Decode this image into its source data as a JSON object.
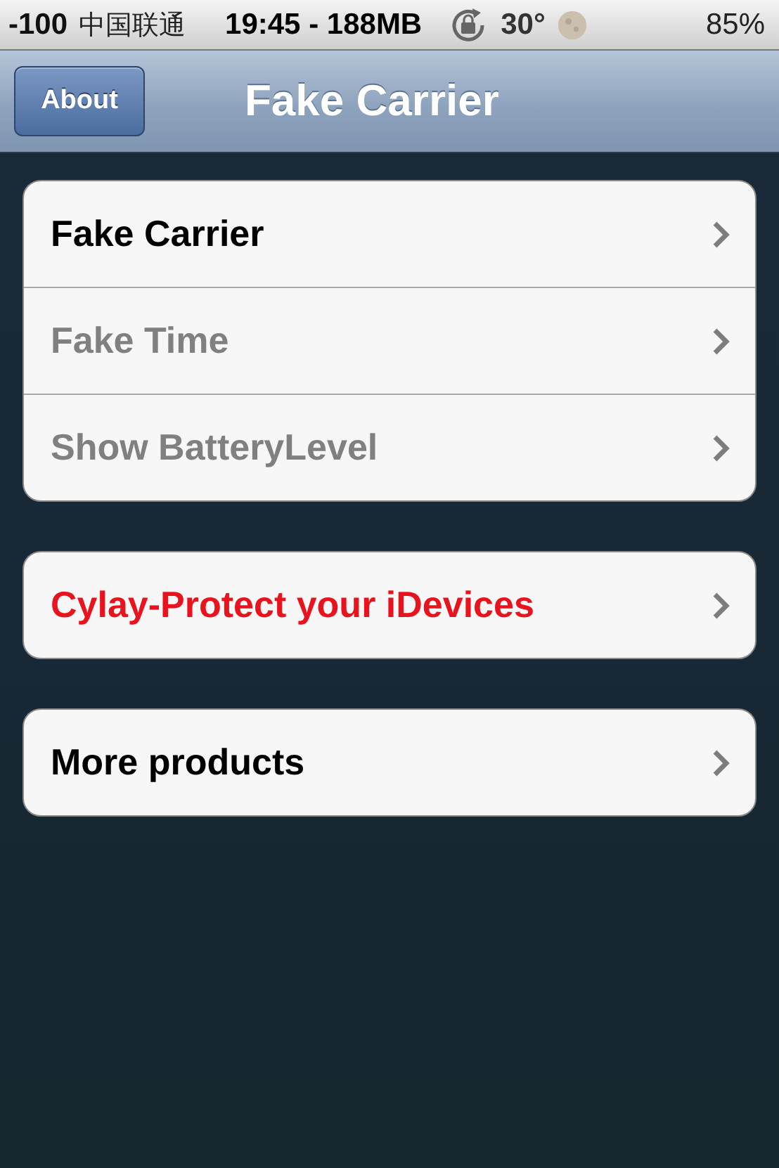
{
  "status_bar": {
    "signal": "-100",
    "carrier": "中国联通",
    "time": "19:45 - 188MB",
    "temperature": "30°",
    "battery": "85%"
  },
  "nav_bar": {
    "back_button": "About",
    "title": "Fake Carrier"
  },
  "groups": [
    {
      "rows": [
        {
          "label": "Fake Carrier",
          "kind": "normal"
        },
        {
          "label": "Fake Time",
          "kind": "dimmed"
        },
        {
          "label": "Show BatteryLevel",
          "kind": "dimmed"
        }
      ]
    },
    {
      "rows": [
        {
          "label": "Cylay-Protect your iDevices",
          "kind": "promo"
        }
      ]
    },
    {
      "rows": [
        {
          "label": "More products",
          "kind": "normal"
        }
      ]
    }
  ]
}
